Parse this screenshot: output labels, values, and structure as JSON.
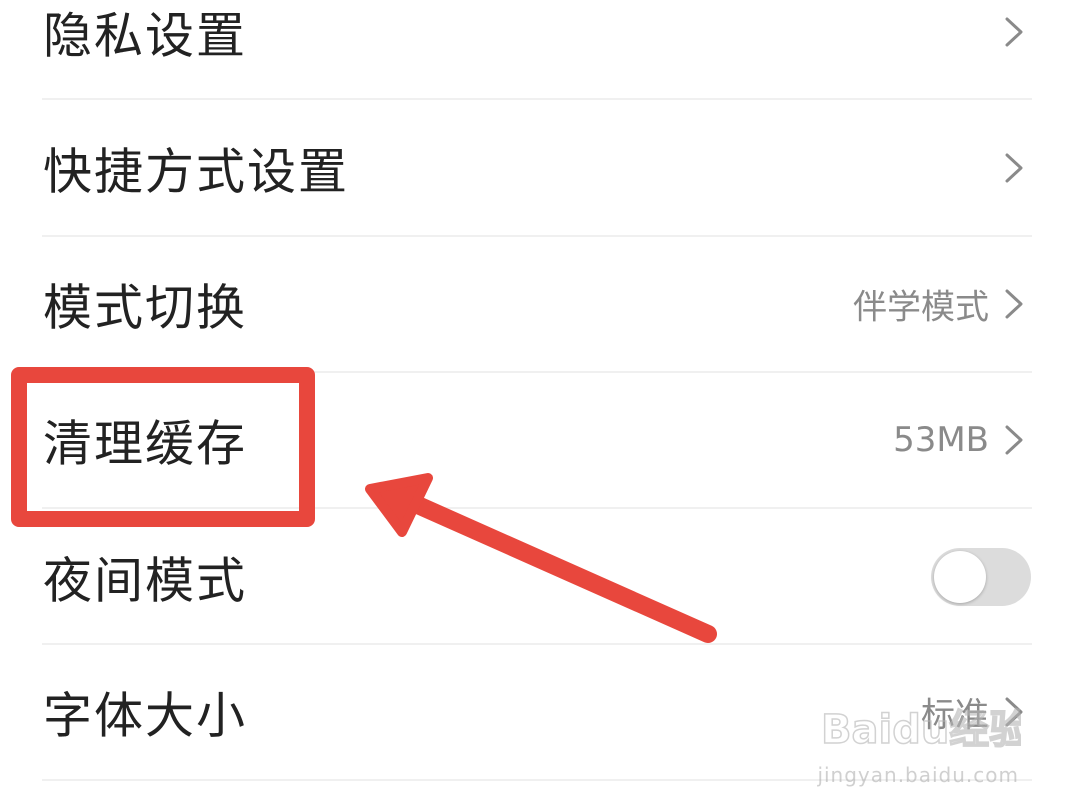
{
  "settings": {
    "items": [
      {
        "label": "隐私设置",
        "value": "",
        "control": "chevron"
      },
      {
        "label": "快捷方式设置",
        "value": "",
        "control": "chevron"
      },
      {
        "label": "模式切换",
        "value": "伴学模式",
        "control": "chevron"
      },
      {
        "label": "清理缓存",
        "value": "53MB",
        "control": "chevron"
      },
      {
        "label": "夜间模式",
        "value": "",
        "control": "toggle",
        "toggle_on": false
      },
      {
        "label": "字体大小",
        "value": "标准",
        "control": "chevron"
      }
    ]
  },
  "annotation": {
    "highlight_color": "#e8473d"
  },
  "watermark": {
    "brand": "Baidu经验",
    "url": "jingyan.baidu.com"
  },
  "colors": {
    "label": "#222222",
    "value": "#8a8a8a",
    "chevron": "#8a8a8a",
    "divider": "#f0f0f0",
    "toggle_off": "#dcdcdc"
  }
}
